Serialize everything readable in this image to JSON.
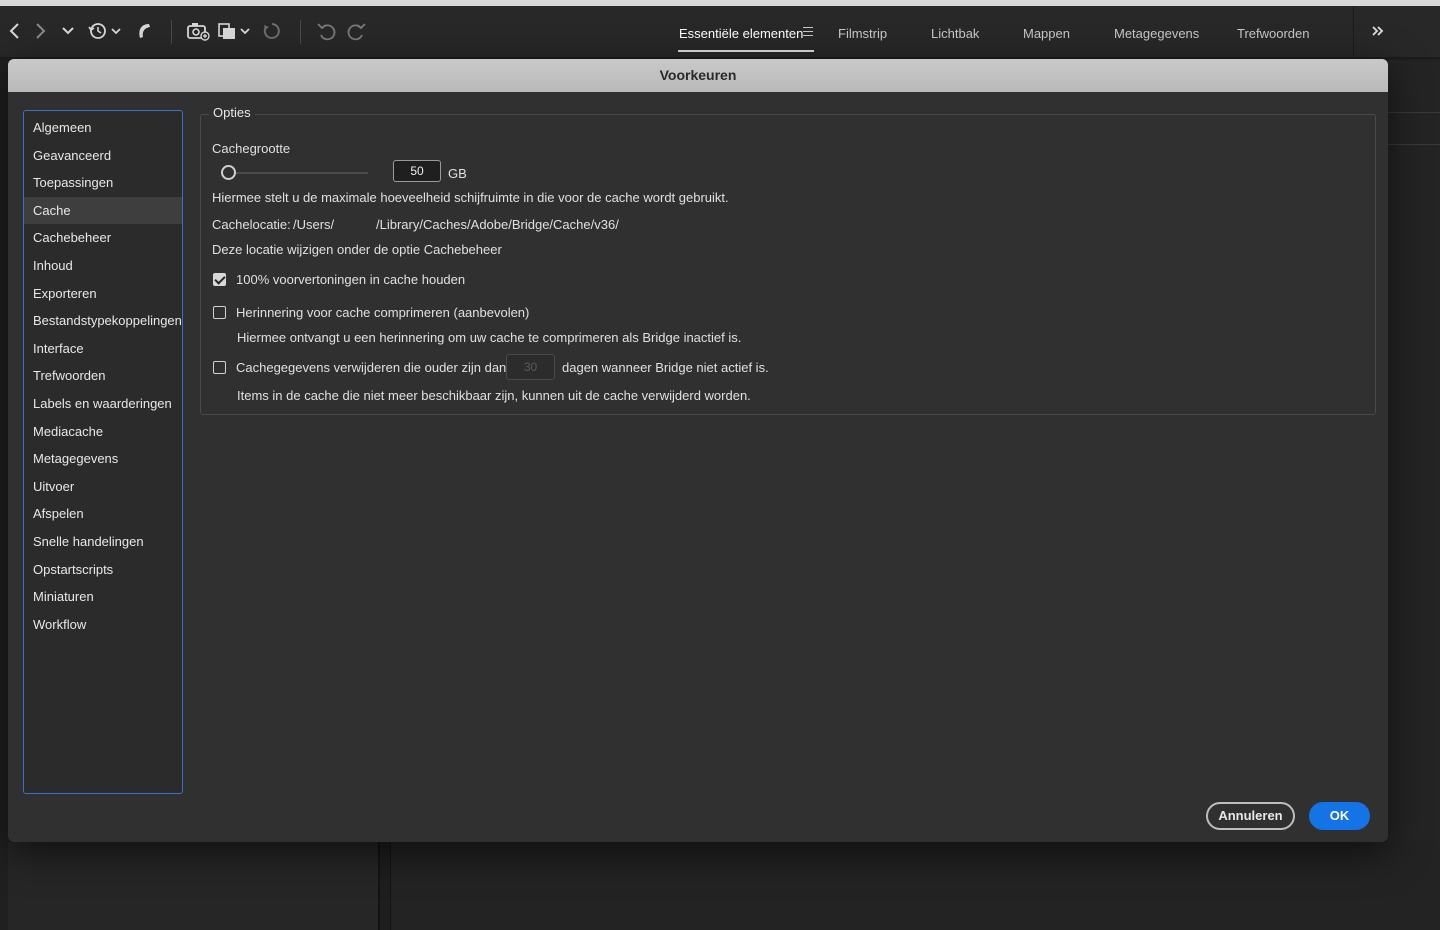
{
  "workspace_tabs": [
    {
      "label": "Essentiële elementen",
      "active": true
    },
    {
      "label": "Filmstrip",
      "active": false
    },
    {
      "label": "Lichtbak",
      "active": false
    },
    {
      "label": "Mappen",
      "active": false
    },
    {
      "label": "Metagegevens",
      "active": false
    },
    {
      "label": "Trefwoorden",
      "active": false
    }
  ],
  "toolbar": {
    "icons": [
      "back-arrow-icon",
      "forward-arrow-icon",
      "chevron-down-icon",
      "recent-history-icon",
      "boomerang-icon",
      "camera-import-icon",
      "copy-stack-icon",
      "refine-icon",
      "rotate-left-icon",
      "rotate-right-icon",
      "overflow-chevrons-icon"
    ]
  },
  "dialog": {
    "title": "Voorkeuren",
    "sidebar": [
      {
        "label": "Algemeen",
        "selected": false
      },
      {
        "label": "Geavanceerd",
        "selected": false
      },
      {
        "label": "Toepassingen",
        "selected": false
      },
      {
        "label": "Cache",
        "selected": true
      },
      {
        "label": "Cachebeheer",
        "selected": false
      },
      {
        "label": "Inhoud",
        "selected": false
      },
      {
        "label": "Exporteren",
        "selected": false
      },
      {
        "label": "Bestandstypekoppelingen",
        "selected": false
      },
      {
        "label": "Interface",
        "selected": false
      },
      {
        "label": "Trefwoorden",
        "selected": false
      },
      {
        "label": "Labels en waarderingen",
        "selected": false
      },
      {
        "label": "Mediacache",
        "selected": false
      },
      {
        "label": "Metagegevens",
        "selected": false
      },
      {
        "label": "Uitvoer",
        "selected": false
      },
      {
        "label": "Afspelen",
        "selected": false
      },
      {
        "label": "Snelle handelingen",
        "selected": false
      },
      {
        "label": "Opstartscripts",
        "selected": false
      },
      {
        "label": "Miniaturen",
        "selected": false
      },
      {
        "label": "Workflow",
        "selected": false
      }
    ],
    "options": {
      "legend": "Opties",
      "cache_size_label": "Cachegrootte",
      "cache_size_value": "50",
      "cache_size_unit": "GB",
      "cache_size_desc": "Hiermee stelt u de maximale hoeveelheid schijfruimte in die voor de cache wordt gebruikt.",
      "cache_location_label": "Cachelocatie:",
      "cache_location_user": "/Users/",
      "cache_location_path": "/Library/Caches/Adobe/Bridge/Cache/v36/",
      "cache_location_note": "Deze locatie wijzigen onder de optie Cachebeheer",
      "keep_previews_label": "100% voorvertoningen in cache houden",
      "keep_previews_checked": true,
      "compress_reminder_label": "Herinnering voor cache comprimeren (aanbevolen)",
      "compress_reminder_checked": false,
      "compress_reminder_desc": "Hiermee ontvangt u een herinnering om uw cache te comprimeren als Bridge inactief is.",
      "purge_label_before": "Cachegegevens verwijderen die ouder zijn dan",
      "purge_days_value": "30",
      "purge_label_after": "dagen wanneer Bridge niet actief is.",
      "purge_checked": false,
      "purge_desc": "Items in de cache die niet meer beschikbaar zijn, kunnen uit de cache verwijderd worden."
    },
    "buttons": {
      "cancel": "Annuleren",
      "ok": "OK"
    }
  },
  "colors": {
    "accent": "#1473e6",
    "dialog_bg": "#303030",
    "title_bar": "#c4c4c4"
  }
}
